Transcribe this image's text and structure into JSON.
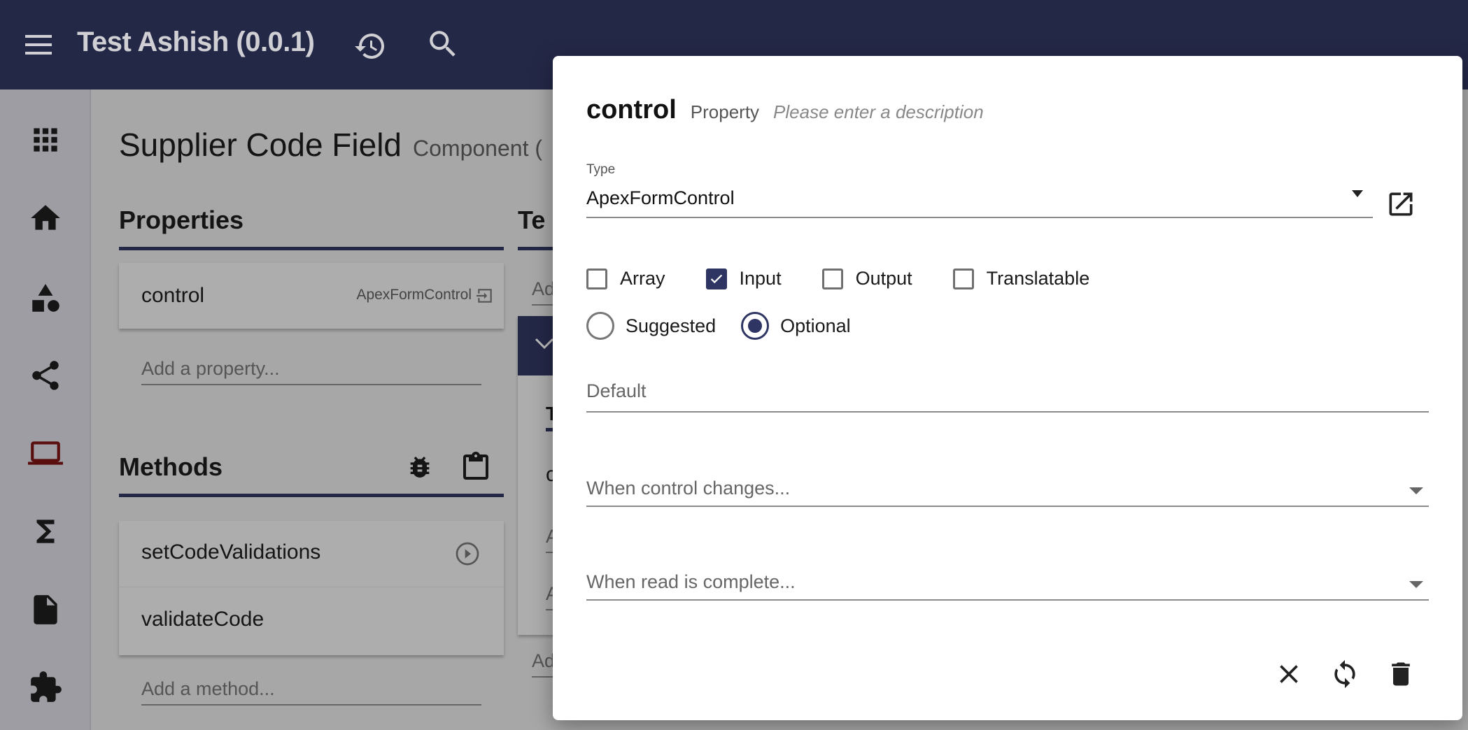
{
  "header": {
    "title": "Test Ashish (0.0.1)",
    "icons": [
      "menu-icon",
      "history-icon",
      "search-icon"
    ]
  },
  "sidebar": {
    "items": [
      "apps-icon",
      "home-icon",
      "shapes-icon",
      "share-icon",
      "laptop-icon",
      "sigma-icon",
      "file-icon",
      "puzzle-icon"
    ],
    "active": "laptop-icon",
    "active_color": "#5a0e0e"
  },
  "page": {
    "title": "Supplier Code Field",
    "subtitle": "Component ("
  },
  "properties": {
    "heading": "Properties",
    "items": [
      {
        "name": "control",
        "type": "ApexFormControl"
      }
    ],
    "add_placeholder": "Add a property..."
  },
  "methods": {
    "heading": "Methods",
    "items": [
      {
        "name": "setCodeValidations"
      },
      {
        "name": "validateCode"
      }
    ],
    "add_placeholder": "Add a method..."
  },
  "middle": {
    "heading": "Te",
    "add1": "Ad",
    "tab": "T",
    "row": "c",
    "a1": "A",
    "a2": "A",
    "add2": "Ad"
  },
  "modal": {
    "name": "control",
    "kind": "Property",
    "description_placeholder": "Please enter a description",
    "type_label": "Type",
    "type_value": "ApexFormControl",
    "checkboxes": [
      {
        "label": "Array",
        "checked": false
      },
      {
        "label": "Input",
        "checked": true
      },
      {
        "label": "Output",
        "checked": false
      },
      {
        "label": "Translatable",
        "checked": false
      }
    ],
    "radios": [
      {
        "label": "Suggested",
        "selected": false
      },
      {
        "label": "Optional",
        "selected": true
      }
    ],
    "default_placeholder": "Default",
    "on_change_placeholder": "When control changes...",
    "on_read_placeholder": "When read is complete..."
  },
  "accent": "#242847"
}
